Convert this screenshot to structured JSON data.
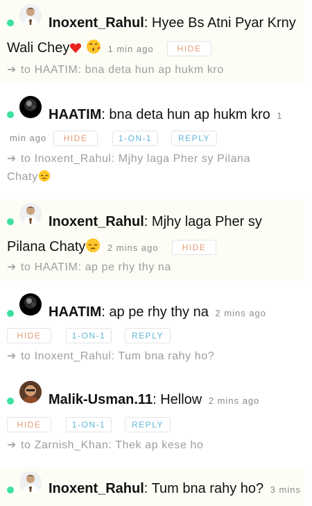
{
  "buttons": {
    "hide": "HIDE",
    "one_on_one": "1-ON-1",
    "reply": "REPLY"
  },
  "arrow": "➜",
  "messages": [
    {
      "user": "Inoxent_Rahul",
      "sep": ":",
      "text": "Hyee Bs Atni Pyar Krny",
      "text2": "Wali Chey",
      "emojis": [
        "heart",
        "kiss"
      ],
      "time": "1 min ago",
      "to_prefix": "to HAATIM:",
      "to_text": "bna deta hun ap hukm kro"
    },
    {
      "user": "HAATIM",
      "sep": ":",
      "text": "bna deta hun ap hukm kro",
      "time_part1": "1",
      "time_part2": "min ago",
      "to_prefix": "to Inoxent_Rahul:",
      "to_text": "Mjhy laga Pher sy Pilana",
      "to_text2": "Chaty",
      "to_emoji": "pensive"
    },
    {
      "user": "Inoxent_Rahul",
      "sep": ":",
      "text": "Mjhy laga Pher sy",
      "text2": "Pilana Chaty",
      "emojis": [
        "pensive"
      ],
      "time": "2 mins ago",
      "to_prefix": "to HAATIM:",
      "to_text": "ap pe rhy thy na"
    },
    {
      "user": "HAATIM",
      "sep": ":",
      "text": "ap pe rhy thy na",
      "time": "2 mins ago",
      "to_prefix": "to Inoxent_Rahul:",
      "to_text": "Tum bna rahy ho?"
    },
    {
      "user": "Malik-Usman.11",
      "sep": ":",
      "text": "Hellow",
      "time": "2 mins ago",
      "to_prefix": "to Zarnish_Khan:",
      "to_text": "Thek ap kese ho"
    },
    {
      "user": "Inoxent_Rahul",
      "sep": ":",
      "text": "Tum bna rahy ho?",
      "time": "3 mins"
    }
  ],
  "colors": {
    "online": "#3ee0a0",
    "hide": "#e49b74",
    "action": "#5fb6d8",
    "tint": "#fdfdf6"
  }
}
